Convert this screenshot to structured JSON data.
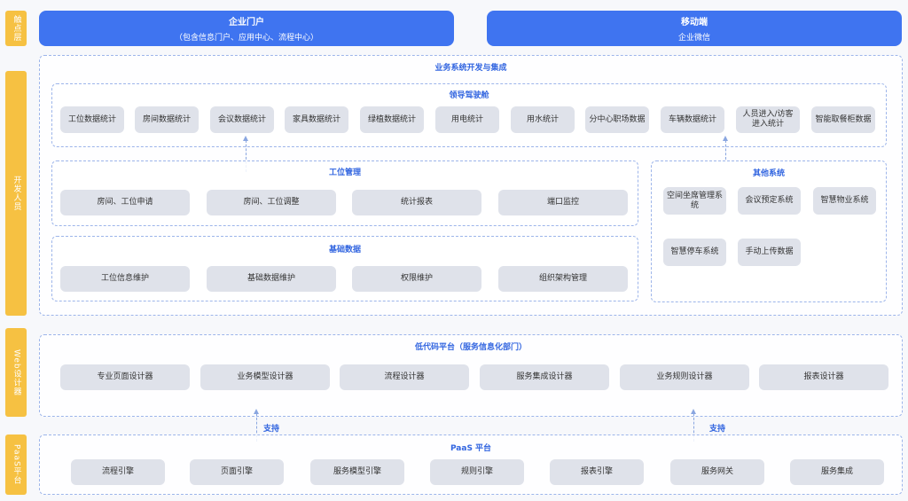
{
  "sides": {
    "touch": "触点层",
    "dev": "开发人员",
    "web": "Web设计器",
    "paas": "PaaS平台"
  },
  "top": {
    "enterprise_title": "企业门户",
    "enterprise_sub": "（包含信息门户、应用中心、流程中心）",
    "mobile_title": "移动端",
    "mobile_sub": "企业微信"
  },
  "business": {
    "title": "业务系统开发与集成",
    "cockpit": {
      "title": "领导驾驶舱",
      "items": [
        "工位数据统计",
        "房间数据统计",
        "会议数据统计",
        "家具数据统计",
        "绿植数据统计",
        "用电统计",
        "用水统计",
        "分中心职场数据",
        "车辆数据统计",
        "人员进入/访客进入统计",
        "智能取餐柜数据"
      ]
    },
    "workstation": {
      "title": "工位管理",
      "items": [
        "房间、工位申请",
        "房间、工位调整",
        "统计报表",
        "端口监控"
      ]
    },
    "basic": {
      "title": "基础数据",
      "items": [
        "工位信息维护",
        "基础数据维护",
        "权限维护",
        "组织架构管理"
      ]
    },
    "other": {
      "title": "其他系统",
      "items": [
        "空间坐席管理系统",
        "会议预定系统",
        "智慧物业系统",
        "智慧停车系统",
        "手动上传数据"
      ]
    }
  },
  "lowcode": {
    "title": "低代码平台（服务信息化部门）",
    "items": [
      "专业页面设计器",
      "业务模型设计器",
      "流程设计器",
      "服务集成设计器",
      "业务规则设计器",
      "报表设计器"
    ]
  },
  "support_label": "支持",
  "paas": {
    "title": "PaaS 平台",
    "items": [
      "流程引擎",
      "页面引擎",
      "服务模型引擎",
      "规则引擎",
      "报表引擎",
      "服务网关",
      "服务集成"
    ]
  },
  "colors": {
    "primary": "#3f74f0",
    "side": "#f6c142",
    "card": "#dfe2ea",
    "title": "#3366e0"
  }
}
